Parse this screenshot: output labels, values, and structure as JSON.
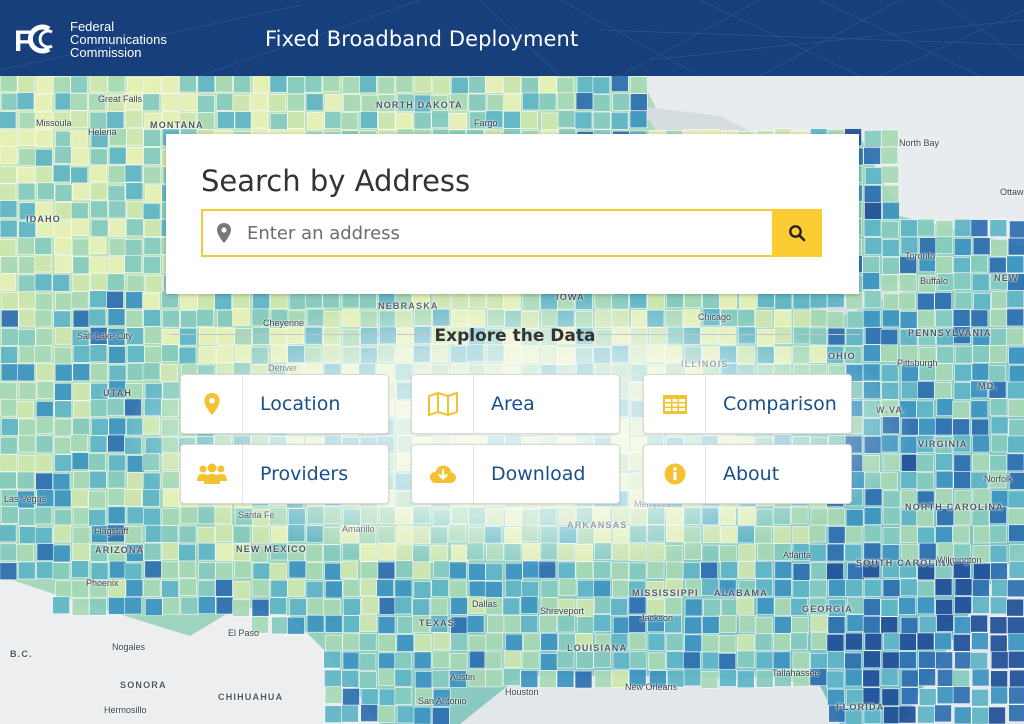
{
  "header": {
    "logo_initials": "FCC",
    "logo_lines": [
      "Federal",
      "Communications",
      "Commission"
    ],
    "title": "Fixed Broadband Deployment",
    "bg_color": "#163f7c"
  },
  "search": {
    "title": "Search by Address",
    "placeholder": "Enter an address",
    "value": "",
    "pin_icon": "map-marker-icon",
    "button_icon": "search-icon",
    "accent_color": "#fccc33"
  },
  "explore": {
    "title": "Explore the Data",
    "tiles": [
      {
        "label": "Location",
        "icon": "map-marker-icon"
      },
      {
        "label": "Area",
        "icon": "map-icon"
      },
      {
        "label": "Comparison",
        "icon": "table-icon"
      },
      {
        "label": "Providers",
        "icon": "users-icon"
      },
      {
        "label": "Download",
        "icon": "cloud-download-icon"
      },
      {
        "label": "About",
        "icon": "info-icon"
      }
    ],
    "icon_color": "#f2c230",
    "label_color": "#1a4f8a"
  },
  "map": {
    "states": [
      "NORTH DAKOTA",
      "MONTANA",
      "IDAHO",
      "NEBRASKA",
      "IOWA",
      "UTAH",
      "ILLINOIS",
      "OHIO",
      "PENNSYLVANIA",
      "ARIZONA",
      "NEW MEXICO",
      "ARKANSAS",
      "TEXAS",
      "MISSISSIPPI",
      "ALABAMA",
      "LOUISIANA",
      "GEORGIA",
      "SOUTH CAROLINA",
      "NORTH CAROLINA",
      "VIRGINIA",
      "W.VA.",
      "MD.",
      "NEW",
      "FLORIDA",
      "B.C.",
      "SONORA",
      "CHIHUAHUA"
    ],
    "cities": [
      "Great Falls",
      "Missoula",
      "Helena",
      "Fargo",
      "Salt Lake City",
      "Cheyenne",
      "Denver",
      "Chicago",
      "Pittsburgh",
      "Toronto",
      "Buffalo",
      "North Bay",
      "Ottawa",
      "Las Vegas",
      "Flagstaff",
      "Phoenix",
      "Santa Fe",
      "Amarillo",
      "Memphis",
      "Atlanta",
      "Wilmington",
      "Norfolk",
      "Dallas",
      "Shreveport",
      "Jackson",
      "Houston",
      "Austin",
      "San Antonio",
      "New Orleans",
      "Tallahassee",
      "El Paso",
      "Nogales",
      "Hermosillo"
    ]
  }
}
